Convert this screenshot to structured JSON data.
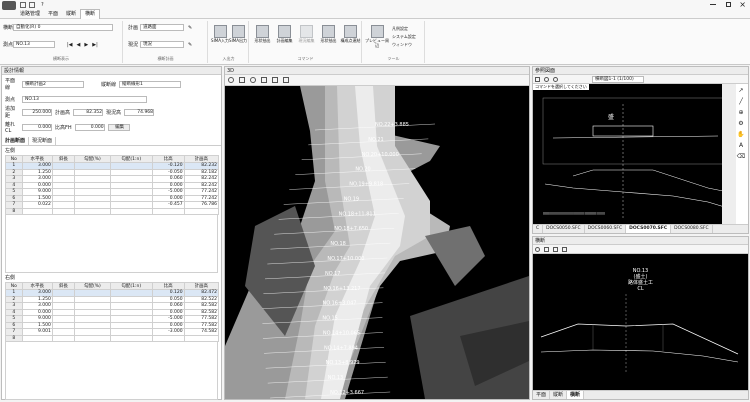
{
  "window": {
    "title": "?",
    "logo": "app-logo"
  },
  "menu": [
    "道路管理",
    "平面",
    "縦断",
    "横断"
  ],
  "ribbon": {
    "left": {
      "route_label": "横断",
      "route_value": "自動化(R) 0",
      "station_label": "測点",
      "station_value": "NO.13",
      "group_label": "横断表示"
    },
    "plan": {
      "label1": "計画",
      "value1": "道路面",
      "label2": "現況",
      "value2": "現況",
      "group_label": "横断計画"
    },
    "io": {
      "b1": "SIMA入力",
      "b2": "SIMA出力",
      "group_label": "入出力"
    },
    "cmd": {
      "b1": "形状抽出",
      "b2": "計画編集",
      "b3": "現況編集",
      "b4": "形状抽出",
      "b5": "構成点連結",
      "group_label": "コマンド"
    },
    "tool": {
      "b1": "プレビュー周辺",
      "c1": "凡例設定",
      "c2": "システム設定",
      "c3": "ウィンドウ",
      "group_label": "ツール"
    }
  },
  "left": {
    "title": "設計情報",
    "r1": {
      "l1": "平面線",
      "v1": "横断計画2",
      "l2": "縦断線",
      "v2": "縦断線形1"
    },
    "r2": {
      "l": "測点",
      "v": "NO.13"
    },
    "r3": {
      "l1": "追加距",
      "v1": "250.000",
      "l2": "計画高",
      "v2": "82.352",
      "l3": "現況高",
      "v3": "74.968"
    },
    "r4": {
      "l1": "離れCL",
      "v1": "0.000",
      "l2": "比高FH",
      "v2": "0.000",
      "btn": "編集"
    },
    "tabs": [
      "計画断面",
      "現況断面"
    ],
    "left_label": "左側",
    "right_label": "右側",
    "cols": [
      "No",
      "水平長",
      "斜長",
      "勾配(%)",
      "勾配(1:n)",
      "比高",
      "計画高"
    ],
    "left_rows": [
      [
        "1",
        "3.000",
        "",
        "",
        "",
        "-0.120",
        "82.232"
      ],
      [
        "2",
        "1.250",
        "",
        "",
        "",
        "-0.050",
        "82.182"
      ],
      [
        "3",
        "3.000",
        "",
        "",
        "",
        "0.060",
        "82.242"
      ],
      [
        "4",
        "0.000",
        "",
        "",
        "",
        "0.000",
        "82.242"
      ],
      [
        "5",
        "9.000",
        "",
        "",
        "",
        "-5.000",
        "77.242"
      ],
      [
        "6",
        "1.500",
        "",
        "",
        "",
        "0.000",
        "77.242"
      ],
      [
        "7",
        "0.022",
        "",
        "",
        "",
        "-0.457",
        "76.786"
      ],
      [
        "8",
        "",
        "",
        "",
        "",
        "",
        ""
      ]
    ],
    "right_rows": [
      [
        "1",
        "3.000",
        "",
        "",
        "",
        "0.120",
        "82.472"
      ],
      [
        "2",
        "1.250",
        "",
        "",
        "",
        "0.050",
        "82.522"
      ],
      [
        "3",
        "3.000",
        "",
        "",
        "",
        "0.060",
        "82.582"
      ],
      [
        "4",
        "0.000",
        "",
        "",
        "",
        "0.000",
        "82.582"
      ],
      [
        "5",
        "9.000",
        "",
        "",
        "",
        "-5.000",
        "77.582"
      ],
      [
        "6",
        "1.500",
        "",
        "",
        "",
        "0.000",
        "77.582"
      ],
      [
        "7",
        "9.001",
        "",
        "",
        "",
        "-3.000",
        "74.582"
      ],
      [
        "8",
        "",
        "",
        "",
        "",
        "",
        ""
      ]
    ]
  },
  "view3d": {
    "title": "3D",
    "stations": [
      "NO.22+3.885",
      "NO.21",
      "NO.20+10.000",
      "NO.20",
      "NO.19+9.818",
      "NO.19",
      "NO.18+11.811",
      "NO.18+7.650",
      "NO.18",
      "NO.17+10.000",
      "NO.17",
      "NO.16+13.217",
      "NO.16+3.047",
      "NO.15",
      "NO.14+10.065",
      "NO.14+7.894",
      "NO.13+8.979",
      "NO.13",
      "NO.12+3.667"
    ]
  },
  "ref": {
    "title": "参照図面",
    "prompt": "コマンドを選択してください",
    "combo": "横断図1-1 (1/100)",
    "tabs": [
      "C",
      "DOCS0050.SFC",
      "DOCS0060.SFC",
      "DOCS0070.SFC",
      "DOCS0080.SFC"
    ],
    "active": 3,
    "label": "盛"
  },
  "xs": {
    "title": "横断",
    "st": "NO.13",
    "l2": "(盛土)",
    "l3": "路体盛土工",
    "cl": "CL"
  },
  "bottom_tabs": [
    "平面",
    "縦断",
    "横断"
  ]
}
